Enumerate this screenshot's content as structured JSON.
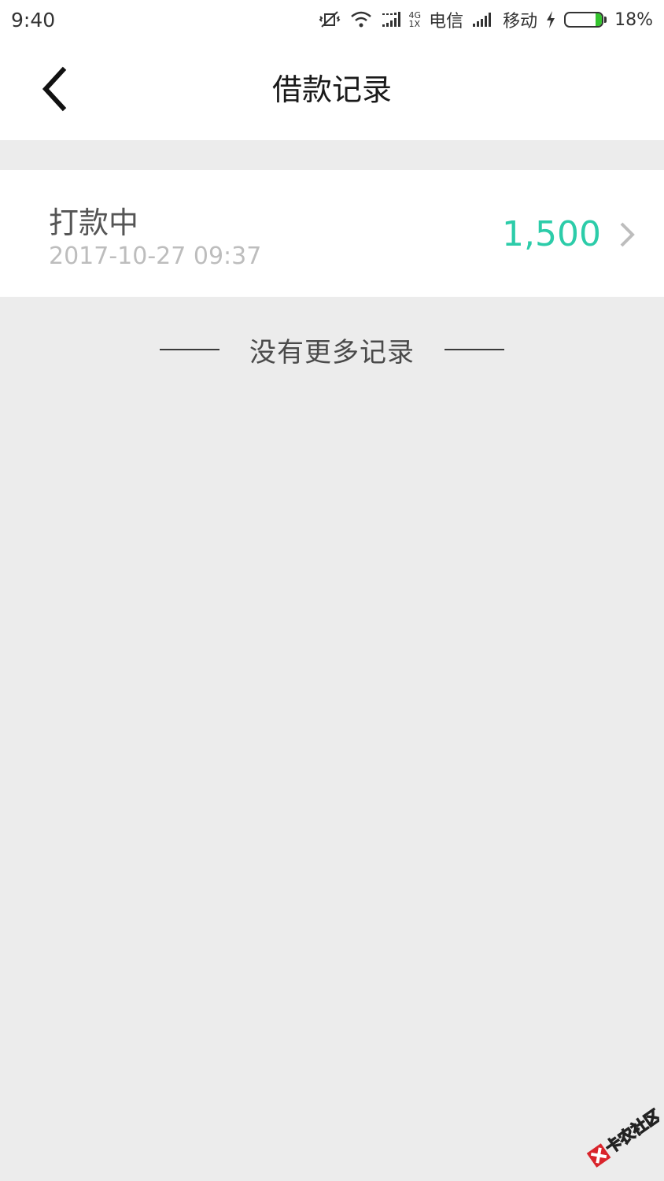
{
  "status_bar": {
    "time": "9:40",
    "net_top": "4G",
    "net_bottom": "1X",
    "carrier1": "电信",
    "carrier2": "移动",
    "battery_percent": "18%",
    "battery_level": 0.18
  },
  "nav": {
    "title": "借款记录"
  },
  "records": [
    {
      "status": "打款中",
      "time": "2017-10-27 09:37",
      "amount": "1,500"
    }
  ],
  "footer": {
    "no_more": "没有更多记录"
  },
  "watermark": {
    "text": "卡农社区"
  },
  "colors": {
    "amount": "#2ccca9",
    "background": "#ececec"
  }
}
